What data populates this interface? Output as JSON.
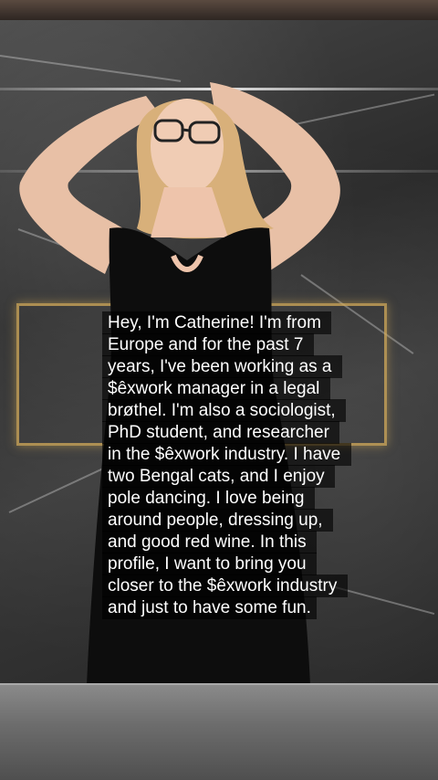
{
  "caption": {
    "text": "Hey, I'm Catherine! I'm from Europe and for the past 7 years, I've been working as a $êxwork manager in a legal brøthel. I'm also a sociologist, PhD student, and researcher in the $êxwork industry. I have two Bengal cats, and I enjoy pole dancing. I love being around people, dressing up, and good red wine. In this profile, I want to bring you closer to the $êxwork industry and just to have some fun."
  },
  "colors": {
    "caption_bg": "#000000",
    "caption_text": "#ffffff",
    "frame_accent": "#d2aa5a"
  }
}
